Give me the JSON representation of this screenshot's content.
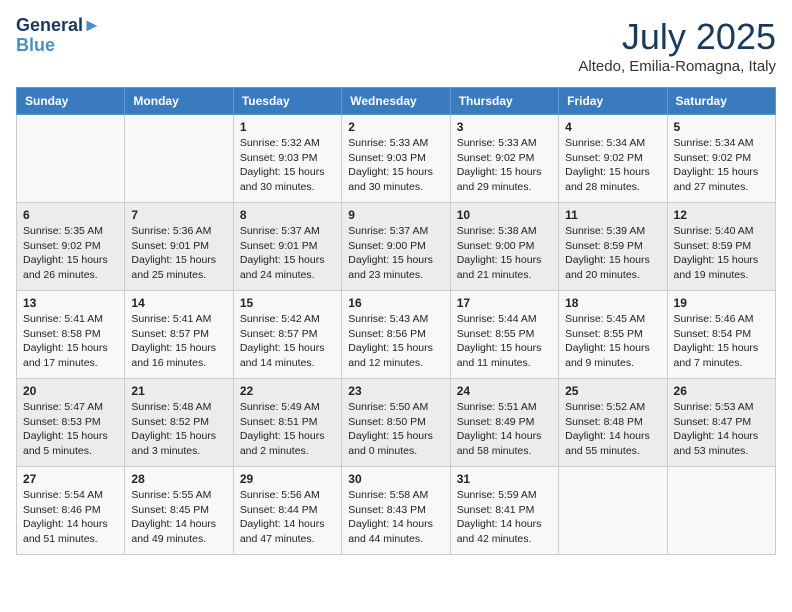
{
  "header": {
    "logo_line1": "General",
    "logo_line2": "Blue",
    "month": "July 2025",
    "location": "Altedo, Emilia-Romagna, Italy"
  },
  "weekdays": [
    "Sunday",
    "Monday",
    "Tuesday",
    "Wednesday",
    "Thursday",
    "Friday",
    "Saturday"
  ],
  "weeks": [
    [
      {
        "day": "",
        "content": ""
      },
      {
        "day": "",
        "content": ""
      },
      {
        "day": "1",
        "content": "Sunrise: 5:32 AM\nSunset: 9:03 PM\nDaylight: 15 hours\nand 30 minutes."
      },
      {
        "day": "2",
        "content": "Sunrise: 5:33 AM\nSunset: 9:03 PM\nDaylight: 15 hours\nand 30 minutes."
      },
      {
        "day": "3",
        "content": "Sunrise: 5:33 AM\nSunset: 9:02 PM\nDaylight: 15 hours\nand 29 minutes."
      },
      {
        "day": "4",
        "content": "Sunrise: 5:34 AM\nSunset: 9:02 PM\nDaylight: 15 hours\nand 28 minutes."
      },
      {
        "day": "5",
        "content": "Sunrise: 5:34 AM\nSunset: 9:02 PM\nDaylight: 15 hours\nand 27 minutes."
      }
    ],
    [
      {
        "day": "6",
        "content": "Sunrise: 5:35 AM\nSunset: 9:02 PM\nDaylight: 15 hours\nand 26 minutes."
      },
      {
        "day": "7",
        "content": "Sunrise: 5:36 AM\nSunset: 9:01 PM\nDaylight: 15 hours\nand 25 minutes."
      },
      {
        "day": "8",
        "content": "Sunrise: 5:37 AM\nSunset: 9:01 PM\nDaylight: 15 hours\nand 24 minutes."
      },
      {
        "day": "9",
        "content": "Sunrise: 5:37 AM\nSunset: 9:00 PM\nDaylight: 15 hours\nand 23 minutes."
      },
      {
        "day": "10",
        "content": "Sunrise: 5:38 AM\nSunset: 9:00 PM\nDaylight: 15 hours\nand 21 minutes."
      },
      {
        "day": "11",
        "content": "Sunrise: 5:39 AM\nSunset: 8:59 PM\nDaylight: 15 hours\nand 20 minutes."
      },
      {
        "day": "12",
        "content": "Sunrise: 5:40 AM\nSunset: 8:59 PM\nDaylight: 15 hours\nand 19 minutes."
      }
    ],
    [
      {
        "day": "13",
        "content": "Sunrise: 5:41 AM\nSunset: 8:58 PM\nDaylight: 15 hours\nand 17 minutes."
      },
      {
        "day": "14",
        "content": "Sunrise: 5:41 AM\nSunset: 8:57 PM\nDaylight: 15 hours\nand 16 minutes."
      },
      {
        "day": "15",
        "content": "Sunrise: 5:42 AM\nSunset: 8:57 PM\nDaylight: 15 hours\nand 14 minutes."
      },
      {
        "day": "16",
        "content": "Sunrise: 5:43 AM\nSunset: 8:56 PM\nDaylight: 15 hours\nand 12 minutes."
      },
      {
        "day": "17",
        "content": "Sunrise: 5:44 AM\nSunset: 8:55 PM\nDaylight: 15 hours\nand 11 minutes."
      },
      {
        "day": "18",
        "content": "Sunrise: 5:45 AM\nSunset: 8:55 PM\nDaylight: 15 hours\nand 9 minutes."
      },
      {
        "day": "19",
        "content": "Sunrise: 5:46 AM\nSunset: 8:54 PM\nDaylight: 15 hours\nand 7 minutes."
      }
    ],
    [
      {
        "day": "20",
        "content": "Sunrise: 5:47 AM\nSunset: 8:53 PM\nDaylight: 15 hours\nand 5 minutes."
      },
      {
        "day": "21",
        "content": "Sunrise: 5:48 AM\nSunset: 8:52 PM\nDaylight: 15 hours\nand 3 minutes."
      },
      {
        "day": "22",
        "content": "Sunrise: 5:49 AM\nSunset: 8:51 PM\nDaylight: 15 hours\nand 2 minutes."
      },
      {
        "day": "23",
        "content": "Sunrise: 5:50 AM\nSunset: 8:50 PM\nDaylight: 15 hours\nand 0 minutes."
      },
      {
        "day": "24",
        "content": "Sunrise: 5:51 AM\nSunset: 8:49 PM\nDaylight: 14 hours\nand 58 minutes."
      },
      {
        "day": "25",
        "content": "Sunrise: 5:52 AM\nSunset: 8:48 PM\nDaylight: 14 hours\nand 55 minutes."
      },
      {
        "day": "26",
        "content": "Sunrise: 5:53 AM\nSunset: 8:47 PM\nDaylight: 14 hours\nand 53 minutes."
      }
    ],
    [
      {
        "day": "27",
        "content": "Sunrise: 5:54 AM\nSunset: 8:46 PM\nDaylight: 14 hours\nand 51 minutes."
      },
      {
        "day": "28",
        "content": "Sunrise: 5:55 AM\nSunset: 8:45 PM\nDaylight: 14 hours\nand 49 minutes."
      },
      {
        "day": "29",
        "content": "Sunrise: 5:56 AM\nSunset: 8:44 PM\nDaylight: 14 hours\nand 47 minutes."
      },
      {
        "day": "30",
        "content": "Sunrise: 5:58 AM\nSunset: 8:43 PM\nDaylight: 14 hours\nand 44 minutes."
      },
      {
        "day": "31",
        "content": "Sunrise: 5:59 AM\nSunset: 8:41 PM\nDaylight: 14 hours\nand 42 minutes."
      },
      {
        "day": "",
        "content": ""
      },
      {
        "day": "",
        "content": ""
      }
    ]
  ]
}
